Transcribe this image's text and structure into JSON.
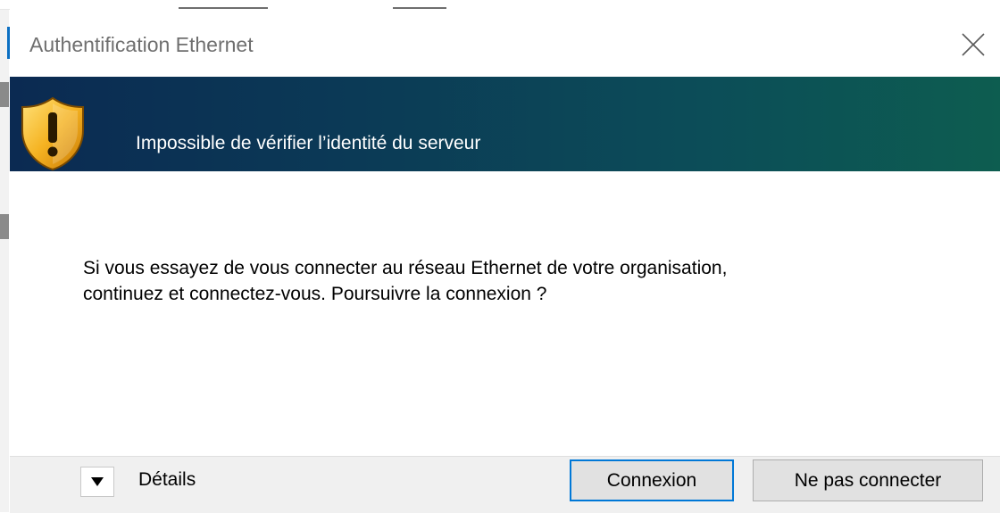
{
  "dialog": {
    "title": "Authentification Ethernet",
    "close_icon": "close-icon",
    "banner": {
      "icon": "shield-warning-icon",
      "message": "Impossible de vérifier l’identité du serveur",
      "gradient_start": "#0b2a52",
      "gradient_end": "#0d5d50"
    },
    "body": {
      "line1": "Si vous essayez de vous connecter au réseau Ethernet de votre organisation,",
      "line2": "continuez et connectez-vous. Poursuivre la connexion ?"
    },
    "footer": {
      "details_icon": "triangle-down-icon",
      "details_label": "Détails",
      "connect_label": "Connexion",
      "dont_connect_label": "Ne pas connecter",
      "accent_color": "#0078d7"
    }
  }
}
